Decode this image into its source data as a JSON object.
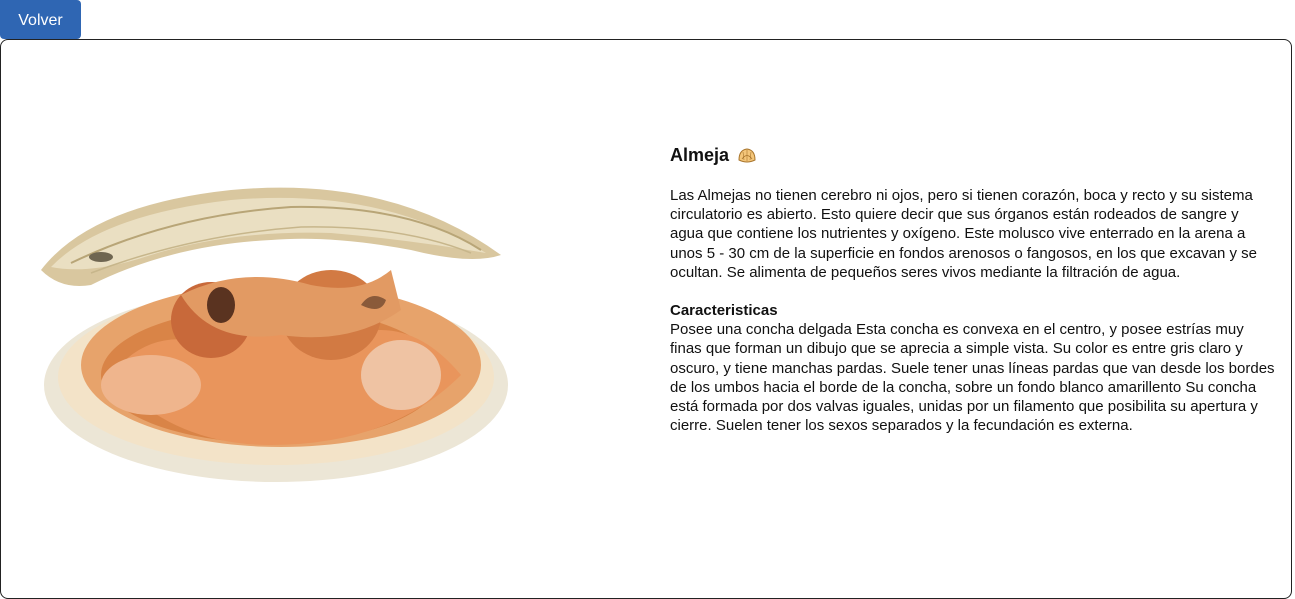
{
  "nav": {
    "back_label": "Volver"
  },
  "article": {
    "title": "Almeja",
    "title_icon": "clam-icon",
    "image_alt": "almeja",
    "description": "Las Almejas no tienen cerebro ni ojos, pero si tienen corazón, boca y recto y su sistema circulatorio es abierto. Esto quiere decir que sus órganos están rodeados de sangre y agua que contiene los nutrientes y oxígeno. Este molusco vive enterrado en la arena a unos 5 - 30 cm de la superficie en fondos arenosos o fangosos, en los que excavan y se ocultan. Se alimenta de pequeños seres vivos mediante la filtración de agua.",
    "features_heading": "Caracteristicas",
    "features_text": "Posee una concha delgada Esta concha es convexa en el centro, y posee estrías muy finas que forman un dibujo que se aprecia a simple vista. Su color es entre gris claro y oscuro, y tiene manchas pardas. Suele tener unas líneas pardas que van desde los bordes de los umbos hacia el borde de la concha, sobre un fondo blanco amarillento Su concha está formada por dos valvas iguales, unidas por un filamento que posibilita su apertura y cierre. Suelen tener los sexos separados y la fecundación es externa."
  },
  "colors": {
    "button_bg": "#2f66b3",
    "button_text": "#ffffff",
    "card_border": "#222222"
  }
}
